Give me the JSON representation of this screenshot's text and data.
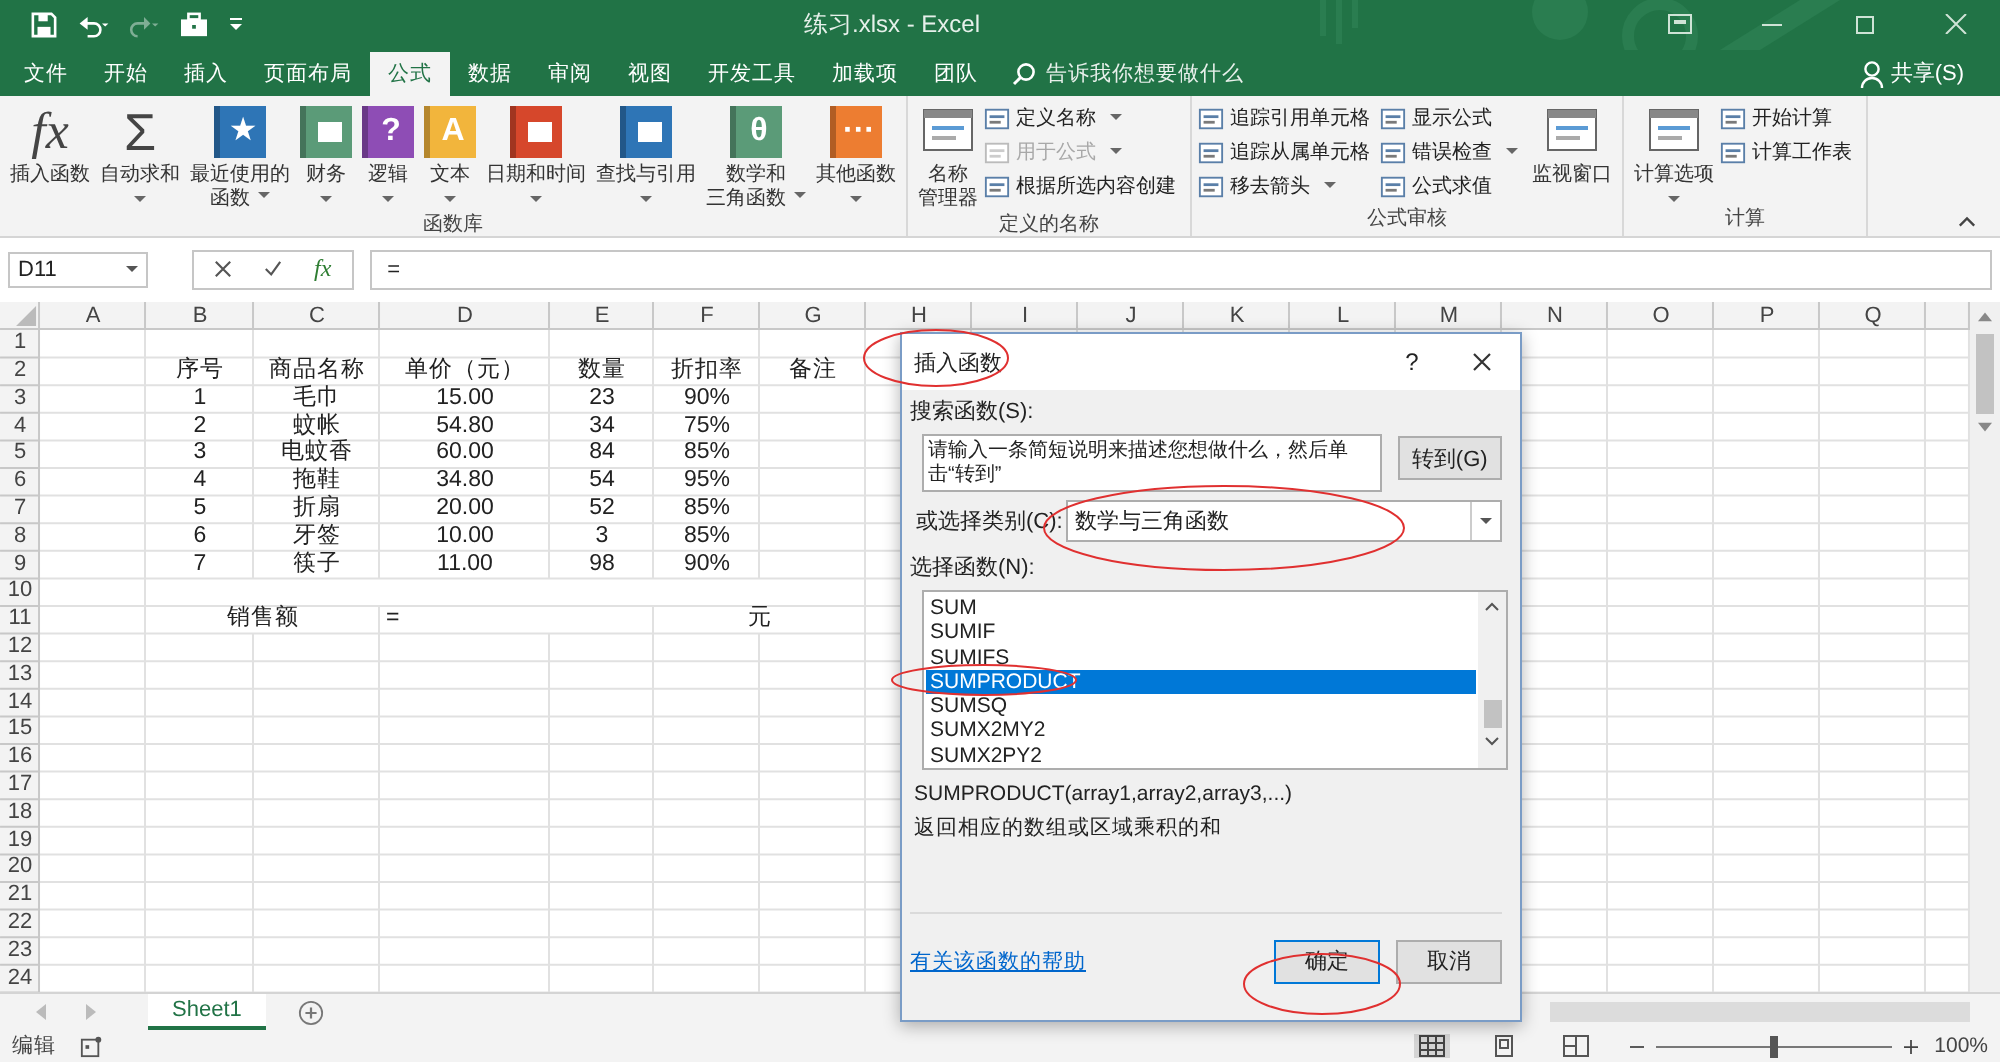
{
  "title_bar": {
    "title": "练习.xlsx  -  Excel"
  },
  "tabs": [
    {
      "label": "文件",
      "selected": false
    },
    {
      "label": "开始",
      "selected": false
    },
    {
      "label": "插入",
      "selected": false
    },
    {
      "label": "页面布局",
      "selected": false
    },
    {
      "label": "公式",
      "selected": true
    },
    {
      "label": "数据",
      "selected": false
    },
    {
      "label": "审阅",
      "selected": false
    },
    {
      "label": "视图",
      "selected": false
    },
    {
      "label": "开发工具",
      "selected": false
    },
    {
      "label": "加载项",
      "selected": false
    },
    {
      "label": "团队",
      "selected": false
    }
  ],
  "search": {
    "placeholder": "告诉我你想要做什么"
  },
  "share": "共享(S)",
  "ribbon": {
    "groups": [
      {
        "label": "函数库",
        "items": [
          {
            "kind": "large",
            "lines": [
              "插入函数"
            ],
            "glyph": "fx",
            "dropdown": false
          },
          {
            "kind": "large",
            "lines": [
              "自动求和"
            ],
            "glyph": "Σ",
            "dropdown": true
          },
          {
            "kind": "large",
            "lines": [
              "最近使用的",
              "函数"
            ],
            "glyph": "★",
            "color": "#2e75b6",
            "dropdown": true
          },
          {
            "kind": "large",
            "lines": [
              "财务"
            ],
            "color": "#5b9b78",
            "dropdown": true
          },
          {
            "kind": "large",
            "lines": [
              "逻辑"
            ],
            "glyph": "?",
            "color": "#8e4db5",
            "dropdown": true
          },
          {
            "kind": "large",
            "lines": [
              "文本"
            ],
            "glyph": "A",
            "color": "#f2b53c",
            "dropdown": true
          },
          {
            "kind": "large",
            "lines": [
              "日期和时间"
            ],
            "color": "#d6472b",
            "dropdown": true
          },
          {
            "kind": "large",
            "lines": [
              "查找与引用"
            ],
            "color": "#2e75b6",
            "dropdown": true
          },
          {
            "kind": "large",
            "lines": [
              "数学和",
              "三角函数"
            ],
            "glyph": "θ",
            "color": "#5b9b78",
            "dropdown": true
          },
          {
            "kind": "large",
            "lines": [
              "其他函数"
            ],
            "glyph": "···",
            "color": "#ed7d31",
            "dropdown": true
          }
        ]
      },
      {
        "label": "定义的名称",
        "items": [
          {
            "kind": "large",
            "lines": [
              "名称",
              "管理器"
            ],
            "dropdown": false
          },
          {
            "kind": "stack",
            "items": [
              {
                "label": "定义名称",
                "dropdown": true,
                "disabled": false
              },
              {
                "label": "用于公式",
                "dropdown": true,
                "disabled": true
              },
              {
                "label": "根据所选内容创建",
                "dropdown": false,
                "disabled": false
              }
            ]
          }
        ]
      },
      {
        "label": "公式审核",
        "items": [
          {
            "kind": "stack",
            "items": [
              {
                "label": "追踪引用单元格",
                "dropdown": false,
                "disabled": false
              },
              {
                "label": "追踪从属单元格",
                "dropdown": false,
                "disabled": false
              },
              {
                "label": "移去箭头",
                "dropdown": true,
                "disabled": false
              }
            ]
          },
          {
            "kind": "stack",
            "items": [
              {
                "label": "显示公式",
                "dropdown": false,
                "disabled": false
              },
              {
                "label": "错误检查",
                "dropdown": true,
                "disabled": false
              },
              {
                "label": "公式求值",
                "dropdown": false,
                "disabled": false
              }
            ]
          },
          {
            "kind": "large",
            "lines": [
              "监视窗口"
            ],
            "dropdown": false
          }
        ]
      },
      {
        "label": "计算",
        "items": [
          {
            "kind": "large",
            "lines": [
              "计算选项"
            ],
            "dropdown": true
          },
          {
            "kind": "stack",
            "items": [
              {
                "label": "开始计算",
                "dropdown": false,
                "disabled": false
              },
              {
                "label": "计算工作表",
                "dropdown": false,
                "disabled": false
              }
            ]
          }
        ]
      }
    ]
  },
  "formula_bar": {
    "name_box": "D11",
    "function_glyph": "fx",
    "value": "="
  },
  "sheet": {
    "columns": [
      "A",
      "B",
      "C",
      "D",
      "E",
      "F",
      "G",
      "H",
      "I",
      "J",
      "K",
      "L",
      "M",
      "N",
      "O",
      "P",
      "Q"
    ],
    "row_numbers": [
      "1",
      "2",
      "3",
      "4",
      "5",
      "6",
      "7",
      "8",
      "9",
      "10",
      "11",
      "12",
      "13",
      "14",
      "15",
      "16",
      "17",
      "18",
      "19",
      "20",
      "21",
      "22",
      "23",
      "24"
    ],
    "table": {
      "header": [
        "序号",
        "商品名称",
        "单价（元）",
        "数量",
        "折扣率",
        "备注"
      ],
      "rows": [
        [
          "1",
          "毛巾",
          "15.00",
          "23",
          "90%"
        ],
        [
          "2",
          "蚊帐",
          "54.80",
          "34",
          "75%"
        ],
        [
          "3",
          "电蚊香",
          "60.00",
          "84",
          "85%"
        ],
        [
          "4",
          "拖鞋",
          "34.80",
          "54",
          "95%"
        ],
        [
          "5",
          "折扇",
          "20.00",
          "52",
          "85%"
        ],
        [
          "6",
          "牙签",
          "10.00",
          "3",
          "85%"
        ],
        [
          "7",
          "筷子",
          "11.00",
          "98",
          "90%"
        ]
      ]
    },
    "total_row": {
      "label": "销售额",
      "value": "=",
      "unit": "元"
    }
  },
  "sheet_tabs": [
    {
      "label": "Sheet1",
      "selected": true
    }
  ],
  "status_bar": {
    "mode": "编辑",
    "zoom": "100%",
    "zoom_slider": {
      "level": 0.5
    }
  },
  "dialog": {
    "title": "插入函数",
    "help_glyph": "?",
    "search_label": "搜索函数(S):",
    "search_value": "请输入一条简短说明来描述您想做什么，然后单击“转到”",
    "go_button": "转到(G)",
    "category_label": "或选择类别(C):",
    "category_value": "数学与三角函数",
    "functions_label": "选择函数(N):",
    "functions": [
      {
        "name": "SUM",
        "selected": false
      },
      {
        "name": "SUMIF",
        "selected": false
      },
      {
        "name": "SUMIFS",
        "selected": false
      },
      {
        "name": "SUMPRODUCT",
        "selected": true
      },
      {
        "name": "SUMSQ",
        "selected": false
      },
      {
        "name": "SUMX2MY2",
        "selected": false
      },
      {
        "name": "SUMX2PY2",
        "selected": false
      }
    ],
    "signature": "SUMPRODUCT(array1,array2,array3,...)",
    "description": "返回相应的数组或区域乘积的和",
    "help_link": "有关该函数的帮助",
    "ok_button": "确定",
    "cancel_button": "取消"
  }
}
